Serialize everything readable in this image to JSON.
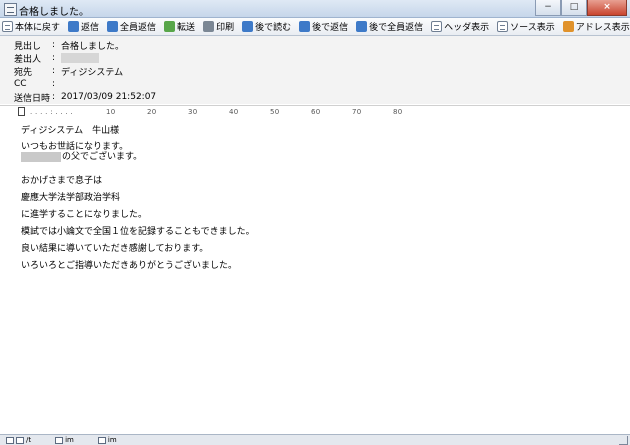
{
  "window": {
    "title": "合格しました。",
    "controls": {
      "minimize": "−",
      "maximize": "□",
      "close": "×"
    }
  },
  "toolbar": [
    {
      "label": "本体に戻す",
      "icon": "return-window-icon"
    },
    {
      "label": "返信",
      "icon": "reply-icon"
    },
    {
      "label": "全員返信",
      "icon": "reply-all-icon"
    },
    {
      "label": "転送",
      "icon": "forward-icon"
    },
    {
      "label": "印刷",
      "icon": "print-icon"
    },
    {
      "label": "後で読む",
      "icon": "read-later-icon"
    },
    {
      "label": "後で返信",
      "icon": "reply-later-icon"
    },
    {
      "label": "後で全員返信",
      "icon": "reply-all-later-icon"
    },
    {
      "label": "ヘッダ表示",
      "icon": "header-view-icon"
    },
    {
      "label": "ソース表示",
      "icon": "source-view-icon"
    },
    {
      "label": "アドレス表示",
      "icon": "address-view-icon"
    }
  ],
  "header": {
    "subject": {
      "key": "見出し",
      "sep": ":",
      "value": "合格しました。"
    },
    "from": {
      "key": "差出人",
      "sep": ":",
      "value": ""
    },
    "to": {
      "key": "宛先",
      "sep": ":",
      "value": "ディジシステム"
    },
    "cc": {
      "key": "CC",
      "sep": ":",
      "value": ""
    },
    "date": {
      "key": "送信日時",
      "sep": ":",
      "value": "2017/03/09 21:52:07"
    }
  },
  "ruler": {
    "ticks": [
      "10",
      "20",
      "30",
      "40",
      "50",
      "60",
      "70",
      "80"
    ]
  },
  "body": {
    "lines": [
      "ディジシステム　牛山様",
      "いつもお世話になります。",
      "の父でございます。",
      "おかげさまで息子は",
      "慶應大学法学部政治学科",
      "に進学することになりました。",
      "模試では小論文で全国１位を記録することもできました。",
      "良い結果に導いていただき感謝しております。",
      "いろいろとご指導いただきありがとうございました。"
    ]
  },
  "statusbar": {
    "items": [
      "/t",
      "im",
      "im"
    ]
  }
}
